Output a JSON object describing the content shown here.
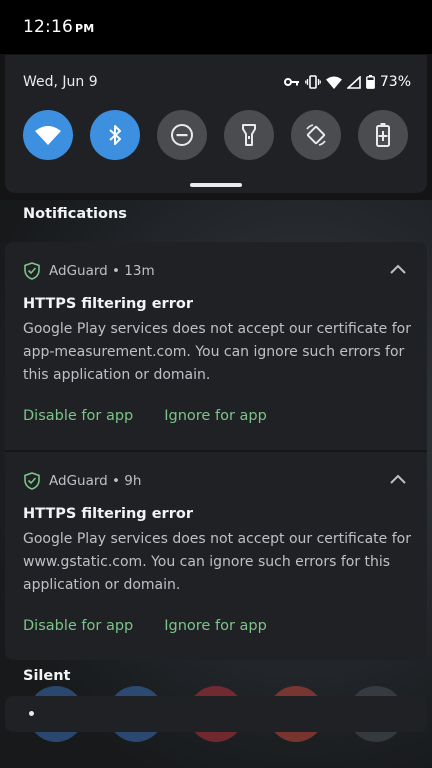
{
  "status_bar": {
    "time": "12:16",
    "ampm": "PM"
  },
  "quick_settings": {
    "date": "Wed, Jun 9",
    "battery": "73%",
    "tiles": [
      {
        "name": "wifi",
        "on": true
      },
      {
        "name": "bluetooth",
        "on": true
      },
      {
        "name": "do-not-disturb",
        "on": false
      },
      {
        "name": "flashlight",
        "on": false
      },
      {
        "name": "auto-rotate",
        "on": false
      },
      {
        "name": "battery-saver",
        "on": false
      }
    ]
  },
  "sections": {
    "notifications": "Notifications",
    "silent": "Silent"
  },
  "notifications": [
    {
      "app": "AdGuard • 13m",
      "title": "HTTPS filtering error",
      "body": "Google Play services does not accept our certificate for app-measurement.com. You can ignore such errors for this application or domain.",
      "action1": "Disable for app",
      "action2": "Ignore for app"
    },
    {
      "app": "AdGuard • 9h",
      "title": "HTTPS filtering error",
      "body": "Google Play services does not accept our certificate for www.gstatic.com. You can ignore such errors for this application or domain.",
      "action1": "Disable for app",
      "action2": "Ignore for app"
    }
  ],
  "colors": {
    "accent": "#3d8fe0",
    "action": "#7cc48a",
    "card": "#202124"
  }
}
